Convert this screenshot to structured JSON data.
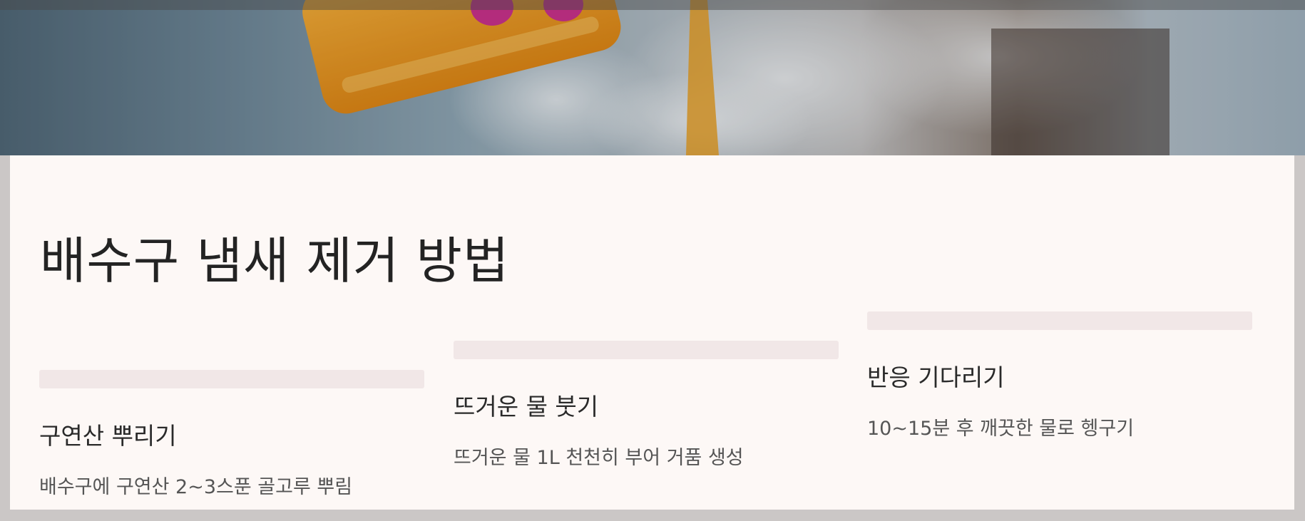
{
  "hero_image": {
    "alt_subject": "orange bottle pouring powder into steaming drain"
  },
  "page_title": "배수구 냄새 제거 방법",
  "steps": [
    {
      "label": "구연산 뿌리기",
      "description": "배수구에 구연산 2~3스푼 골고루 뿌림"
    },
    {
      "label": "뜨거운 물 붓기",
      "description": "뜨거운 물 1L 천천히 부어 거품 생성"
    },
    {
      "label": "반응 기다리기",
      "description": "10~15분 후 깨끗한 물로 헹구기"
    }
  ],
  "colors": {
    "card_background": "#fdf8f6",
    "step_bar": "#f1e7e7",
    "page_background": "#cbc7c6",
    "bottle_orange": "#f59a12",
    "powder": "#f0a11c"
  }
}
